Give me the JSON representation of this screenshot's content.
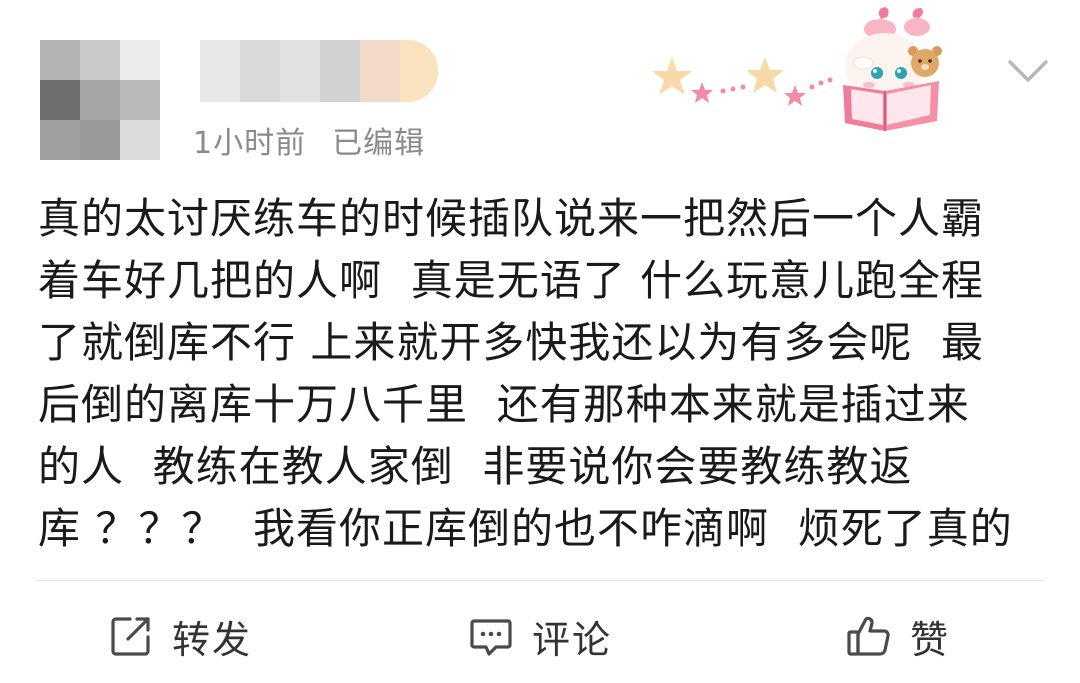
{
  "post": {
    "timestamp": "1小时前",
    "edited": "已编辑",
    "content_lines": [
      "真的太讨厌练车的时候插队说来一把然后一个人霸",
      "着车好几把的人啊  真是无语了 什么玩意儿跑全程",
      "了就倒库不行 上来就开多快我还以为有多会呢  最",
      "后倒的离库十万八千里  还有那种本来就是插过来",
      "的人  教练在教人家倒  非要说你会要教练教返",
      "库 ？？？  我看你正库倒的也不咋滴啊  烦死了真的"
    ]
  },
  "actions": {
    "repost_label": "转发",
    "comment_label": "评论",
    "like_label": "赞"
  },
  "icons": {
    "more": "chevron-down-icon",
    "repost": "share-square-icon",
    "comment": "comment-bubble-icon",
    "like": "thumbs-up-icon",
    "decoration": "deer-reading-book-sticker"
  },
  "colors": {
    "text": "#1a1a1a",
    "meta": "#8a8a8a",
    "divider": "#e6e6e6",
    "icon": "#4a4a4a",
    "star": "#f7d6a8",
    "pink": "#f27a96"
  }
}
